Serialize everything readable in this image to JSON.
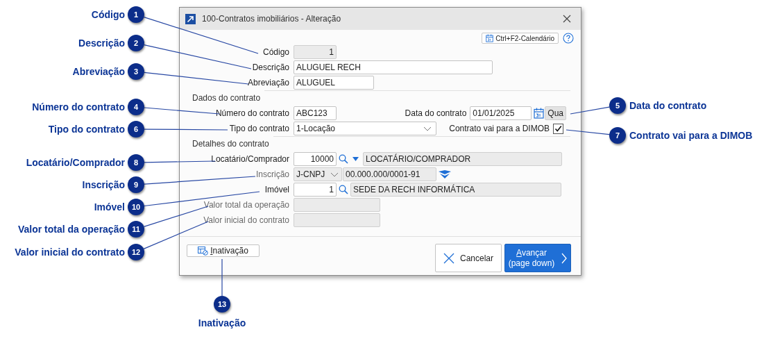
{
  "window": {
    "title": "100-Contratos imobiliários - Alteração"
  },
  "toolbar": {
    "calendar_button": "Ctrl+F2-Calendário"
  },
  "fields": [
    {
      "label": "Código",
      "value": "1",
      "disabled": true
    },
    {
      "label": "Descrição",
      "value": "ALUGUEL RECH",
      "disabled": false
    },
    {
      "label": "Abreviação",
      "value": "ALUGUEL",
      "disabled": false
    }
  ],
  "contract_section": {
    "title": "Dados do contrato",
    "number": {
      "label": "Número do contrato",
      "value": "ABC123"
    },
    "date": {
      "label": "Data do contrato",
      "value": "01/01/2025",
      "weekday": "Qua"
    },
    "type": {
      "label": "Tipo do contrato",
      "value": "1-Locação"
    },
    "dimob": {
      "label": "Contrato vai para a DIMOB",
      "checked": true
    }
  },
  "details_section": {
    "title": "Detalhes do contrato",
    "rows": [
      {
        "kind": "lookup",
        "label": "Locatário/Comprador",
        "code": "10000",
        "description": "LOCATÁRIO/COMPRADOR",
        "dropdown": true
      },
      {
        "kind": "document",
        "label": "Inscrição",
        "type": "J-CNPJ",
        "value": "00.000.000/0001-91",
        "disabled": true
      },
      {
        "kind": "lookup",
        "label": "Imóvel",
        "code": "1",
        "description": "SEDE DA RECH INFORMÁTICA",
        "dropdown": false
      },
      {
        "kind": "amount",
        "label": "Valor total da operação",
        "disabled": true
      },
      {
        "kind": "amount",
        "label": "Valor inicial do contrato",
        "disabled": true
      }
    ]
  },
  "buttons": [
    {
      "kind": "secondary",
      "label": "Inativação"
    },
    {
      "kind": "cancel",
      "label": "Cancelar"
    },
    {
      "kind": "primary",
      "label": "Avançar",
      "hint": "(page down)"
    }
  ],
  "callouts": [
    {
      "number": "1",
      "label": "Código"
    },
    {
      "number": "2",
      "label": "Descrição"
    },
    {
      "number": "3",
      "label": "Abreviação"
    },
    {
      "number": "4",
      "label": "Número do contrato"
    },
    {
      "number": "5",
      "label": "Data do contrato"
    },
    {
      "number": "6",
      "label": "Tipo do contrato"
    },
    {
      "number": "7",
      "label": "Contrato vai para a DIMOB"
    },
    {
      "number": "8",
      "label": "Locatário/Comprador"
    },
    {
      "number": "9",
      "label": "Inscrição"
    },
    {
      "number": "10",
      "label": "Imóvel"
    },
    {
      "number": "11",
      "label": "Valor total da operação"
    },
    {
      "number": "12",
      "label": "Valor inicial do contrato"
    },
    {
      "number": "13",
      "label": "Inativação"
    }
  ]
}
